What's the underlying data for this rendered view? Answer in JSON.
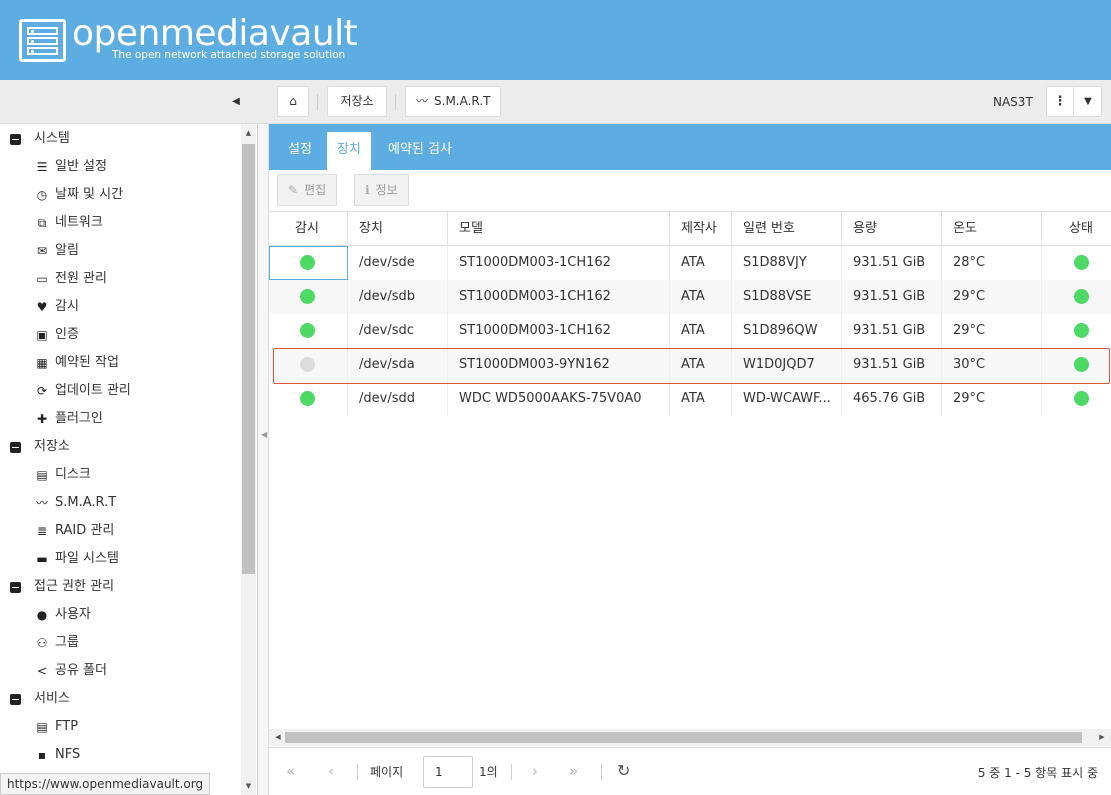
{
  "header": {
    "brand": "openmediavault",
    "tagline": "The open network attached storage solution"
  },
  "breadcrumb": {
    "storage": "저장소",
    "smart": "S.M.A.R.T"
  },
  "host": "NAS3T",
  "sidebar": {
    "groups": [
      {
        "label": "시스템",
        "items": [
          "일반 설정",
          "날짜 및 시간",
          "네트워크",
          "알림",
          "전원 관리",
          "감시",
          "인증",
          "예약된 작업",
          "업데이트 관리",
          "플러그인"
        ]
      },
      {
        "label": "저장소",
        "items": [
          "디스크",
          "S.M.A.R.T",
          "RAID 관리",
          "파일 시스템"
        ]
      },
      {
        "label": "접근 권한 관리",
        "items": [
          "사용자",
          "그룹",
          "공유 폴더"
        ]
      },
      {
        "label": "서비스",
        "items": [
          "FTP",
          "NFS"
        ]
      }
    ]
  },
  "status_url": "https://www.openmediavault.org",
  "tabs": [
    "설정",
    "장치",
    "예약된 검사"
  ],
  "active_tab": "장치",
  "actions": {
    "edit": "편집",
    "info": "정보"
  },
  "table": {
    "columns": [
      "감시",
      "장치",
      "모델",
      "제작사",
      "일련 번호",
      "용량",
      "온도",
      "상태"
    ],
    "rows": [
      {
        "monitor": "on",
        "device": "/dev/sde",
        "model": "ST1000DM003-1CH162",
        "vendor": "ATA",
        "serial": "S1D88VJY",
        "capacity": "931.51 GiB",
        "temp": "28°C",
        "status": "good"
      },
      {
        "monitor": "on",
        "device": "/dev/sdb",
        "model": "ST1000DM003-1CH162",
        "vendor": "ATA",
        "serial": "S1D88VSE",
        "capacity": "931.51 GiB",
        "temp": "29°C",
        "status": "good"
      },
      {
        "monitor": "on",
        "device": "/dev/sdc",
        "model": "ST1000DM003-1CH162",
        "vendor": "ATA",
        "serial": "S1D896QW",
        "capacity": "931.51 GiB",
        "temp": "29°C",
        "status": "good"
      },
      {
        "monitor": "off",
        "device": "/dev/sda",
        "model": "ST1000DM003-9YN162",
        "vendor": "ATA",
        "serial": "W1D0JQD7",
        "capacity": "931.51 GiB",
        "temp": "30°C",
        "status": "good"
      },
      {
        "monitor": "on",
        "device": "/dev/sdd",
        "model": "WDC WD5000AAKS-75V0A0",
        "vendor": "ATA",
        "serial": "WD-WCAWF...",
        "capacity": "465.76 GiB",
        "temp": "29°C",
        "status": "good"
      }
    ]
  },
  "pager": {
    "page_label": "페이지",
    "page_value": "1",
    "page_of": "1의",
    "summary": "5 중 1 - 5 항목 표시 중"
  },
  "colors": {
    "accent": "#5dade2",
    "ok": "#4cd964",
    "off": "#dcdcdc",
    "highlight": "#d9593b"
  }
}
